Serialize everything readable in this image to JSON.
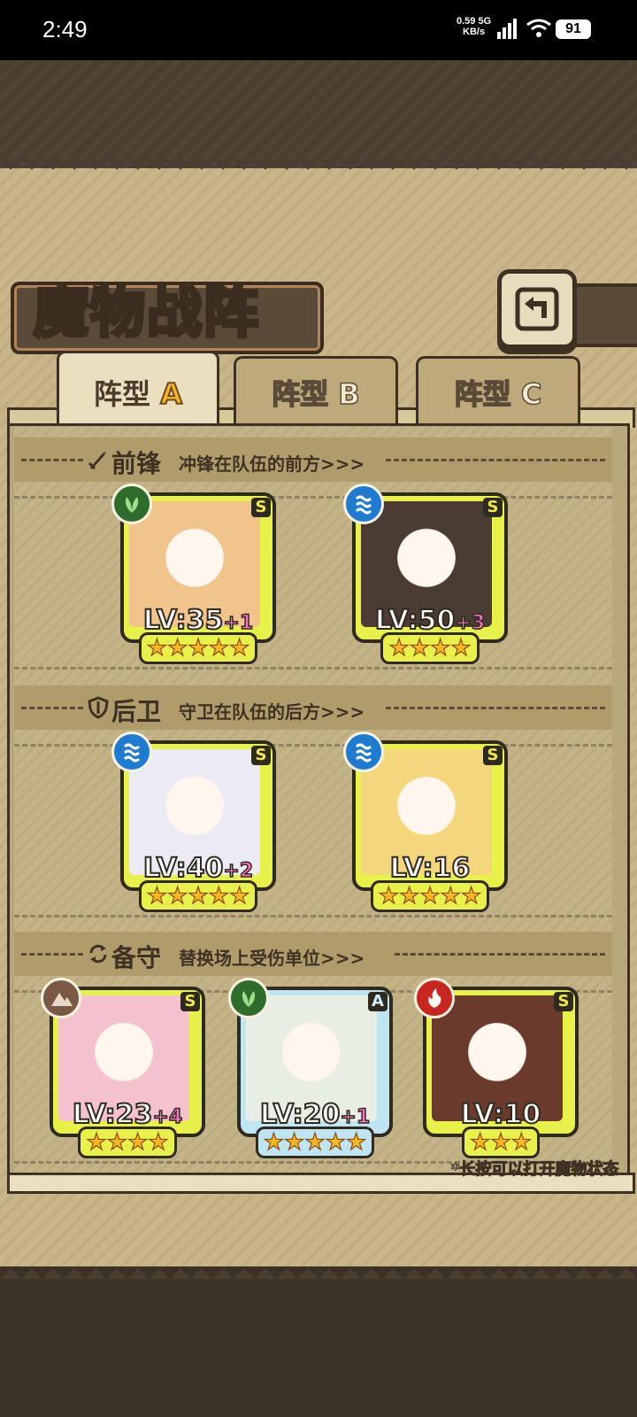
{
  "status_bar": {
    "time": "2:49",
    "net_speed": "0.59",
    "net_unit": "KB/s",
    "net_type": "5G",
    "battery": "91"
  },
  "screen": {
    "title": "魔物战阵",
    "hint": "*长按可以打开魔物状态"
  },
  "tabs": [
    {
      "prefix": "阵型",
      "letter": "A",
      "active": true
    },
    {
      "prefix": "阵型",
      "letter": "B",
      "active": false
    },
    {
      "prefix": "阵型",
      "letter": "C",
      "active": false
    }
  ],
  "sections": [
    {
      "label": "前锋",
      "desc": "冲锋在队伍的前方>>>",
      "icon": "sword-icon"
    },
    {
      "label": "后卫",
      "desc": "守卫在队伍的后方>>>",
      "icon": "shield-icon"
    },
    {
      "label": "备守",
      "desc": "替换场上受伤单位>>>",
      "icon": "swap-icon"
    }
  ],
  "units": {
    "front": [
      {
        "element": "nature",
        "element_color": "#2f6b2a",
        "rank": "S",
        "lv": "LV:35",
        "plus": "+1",
        "stars": "★★★★★",
        "portrait_color": "#f1c48c"
      },
      {
        "element": "water",
        "element_color": "#1f7bd0",
        "rank": "S",
        "lv": "LV:50",
        "plus": "+3",
        "stars": "★★★★",
        "portrait_color": "#4a3b33"
      }
    ],
    "back": [
      {
        "element": "water",
        "element_color": "#1f7bd0",
        "rank": "S",
        "lv": "LV:40",
        "plus": "+2",
        "stars": "★★★★★",
        "portrait_color": "#eceaf2"
      },
      {
        "element": "water",
        "element_color": "#1f7bd0",
        "rank": "S",
        "lv": "LV:16",
        "plus": "",
        "stars": "★★★★★",
        "portrait_color": "#f4d67c"
      }
    ],
    "reserve": [
      {
        "element": "earth",
        "element_color": "#7a5a45",
        "rank": "S",
        "lv": "LV:23",
        "plus": "+4",
        "stars": "★★★★",
        "portrait_color": "#f4c2cf"
      },
      {
        "element": "nature",
        "element_color": "#2f6b2a",
        "rank": "A",
        "lv": "LV:20",
        "plus": "+1",
        "stars": "★★★★★",
        "portrait_color": "#e8eee4"
      },
      {
        "element": "fire",
        "element_color": "#c8271f",
        "rank": "S",
        "lv": "LV:10",
        "plus": "",
        "stars": "★★★",
        "portrait_color": "#6a3a2c"
      }
    ]
  }
}
